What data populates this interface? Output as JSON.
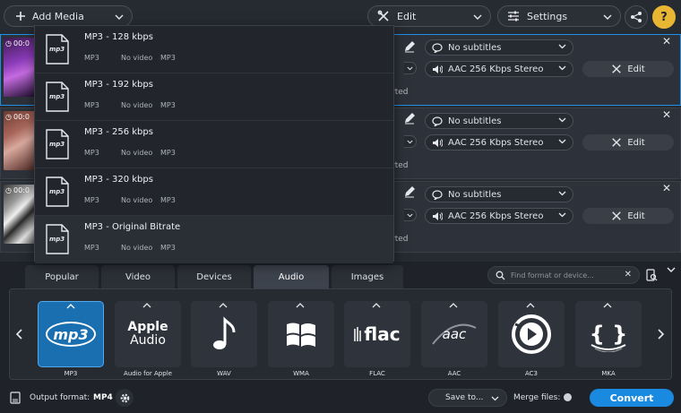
{
  "toolbar": {
    "add_media": "Add Media",
    "edit": "Edit",
    "settings": "Settings"
  },
  "files": [
    {
      "time": "00:0",
      "subtitles": "No subtitles",
      "audio": "AAC 256 Kbps Stereo",
      "edit": "Edit",
      "status": "rted"
    },
    {
      "time": "00:0",
      "subtitles": "No subtitles",
      "audio": "AAC 256 Kbps Stereo",
      "edit": "Edit",
      "status": "rted"
    },
    {
      "time": "00:0",
      "subtitles": "No subtitles",
      "audio": "AAC 256 Kbps Stereo",
      "edit": "Edit",
      "status": "rted"
    }
  ],
  "menu": {
    "items": [
      {
        "icon_text": "mp3",
        "title": "MP3 - 128 kbps",
        "f1": "MP3",
        "f2": "No video",
        "f3": "MP3"
      },
      {
        "icon_text": "mp3",
        "title": "MP3 - 192 kbps",
        "f1": "MP3",
        "f2": "No video",
        "f3": "MP3"
      },
      {
        "icon_text": "mp3",
        "title": "MP3 - 256 kbps",
        "f1": "MP3",
        "f2": "No video",
        "f3": "MP3"
      },
      {
        "icon_text": "mp3",
        "title": "MP3 - 320 kbps",
        "f1": "MP3",
        "f2": "No video",
        "f3": "MP3"
      },
      {
        "icon_text": "mp3",
        "title": "MP3 - Original Bitrate",
        "f1": "MP3",
        "f2": "No video",
        "f3": "MP3"
      }
    ]
  },
  "tabs": [
    "Popular",
    "Video",
    "Devices",
    "Audio",
    "Images"
  ],
  "active_tab": "Audio",
  "search": {
    "placeholder": "Find format or device..."
  },
  "formats": [
    {
      "label": "MP3",
      "icon": "mp3-logo",
      "art": "mp3"
    },
    {
      "label": "Audio for Apple",
      "icon": "apple-audio-logo",
      "art1": "Apple",
      "art2": "Audio"
    },
    {
      "label": "WAV",
      "icon": "music-note-icon"
    },
    {
      "label": "WMA",
      "icon": "windows-logo"
    },
    {
      "label": "FLAC",
      "icon": "flac-logo",
      "art": "flac"
    },
    {
      "label": "AAC",
      "icon": "aac-logo",
      "art": "aac"
    },
    {
      "label": "AC3",
      "icon": "ac3-play-logo"
    },
    {
      "label": "MKA",
      "icon": "mka-braces-logo",
      "art": "{ }"
    }
  ],
  "footer": {
    "output_format_label": "Output format:",
    "output_format_value": "MP4",
    "save_to": "Save to...",
    "merge_files": "Merge files:",
    "convert": "Convert"
  },
  "colors": {
    "accent": "#1a8ae0",
    "background": "#262a31",
    "panel": "#1f2329"
  }
}
